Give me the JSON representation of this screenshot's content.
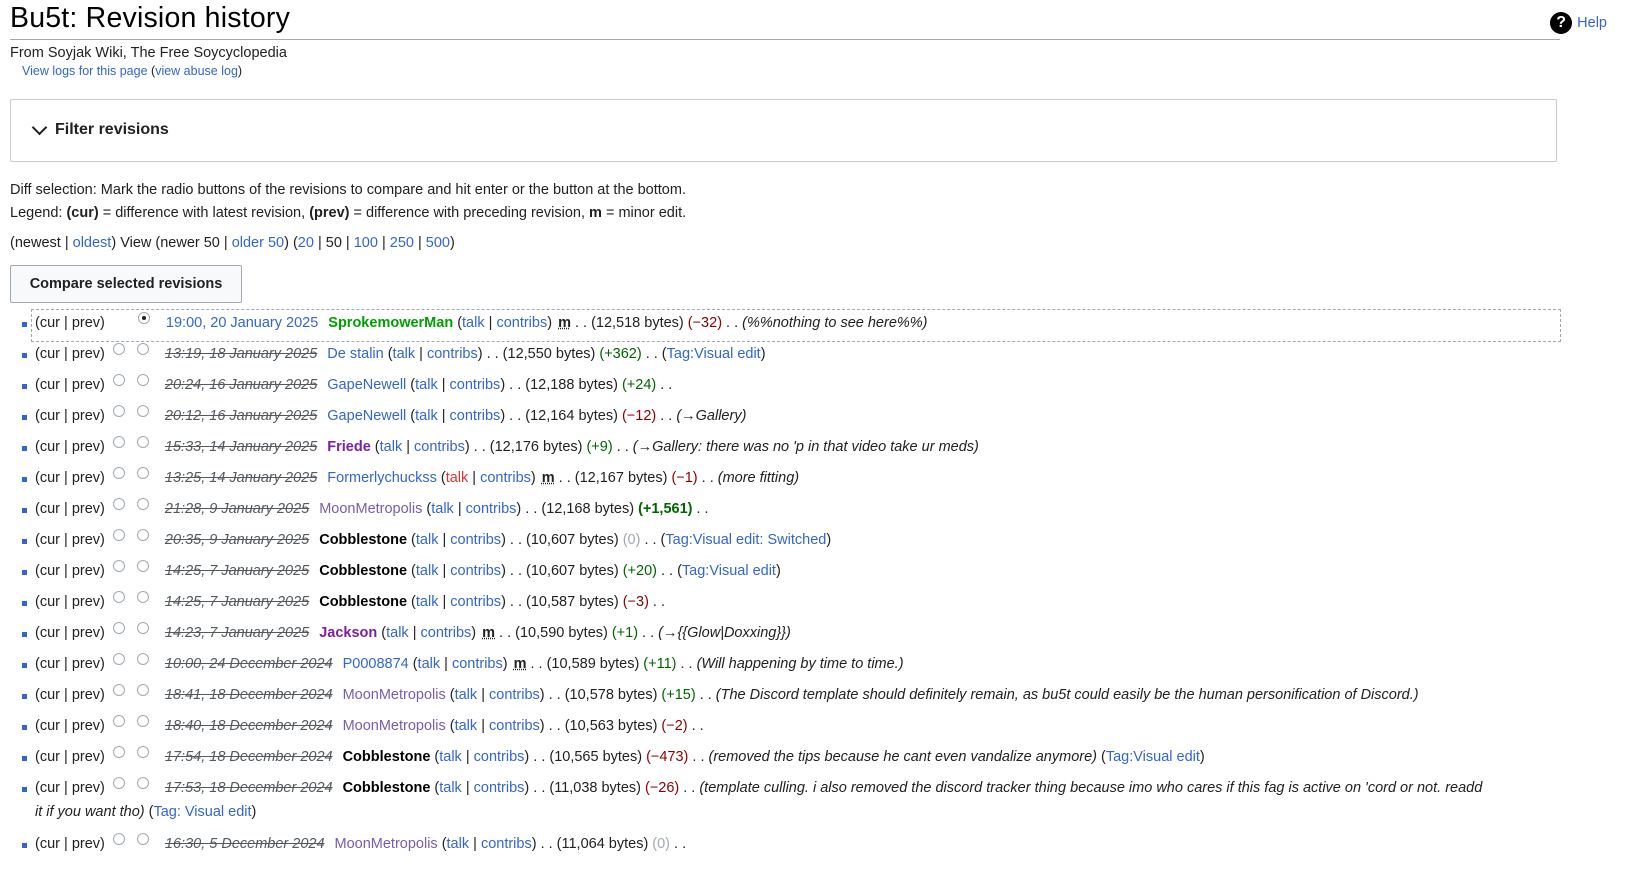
{
  "page": {
    "title": "Bu5t: Revision history",
    "help": "Help",
    "subtitle": "From Soyjak Wiki, The Free Soycyclopedia",
    "view_logs": "View logs for this page",
    "view_abuse_log": "view abuse log"
  },
  "filter": {
    "label": "Filter revisions"
  },
  "info": {
    "diff_selection": "Diff selection: Mark the radio buttons of the revisions to compare and hit enter or the button at the bottom.",
    "legend_prefix": "Legend: ",
    "legend_cur": "(cur)",
    "legend_cur_desc": " = difference with latest revision, ",
    "legend_prev": "(prev)",
    "legend_prev_desc": " = difference with preceding revision, ",
    "legend_m": "m",
    "legend_m_desc": " = minor edit."
  },
  "nav": {
    "newest": "newest",
    "oldest": "oldest",
    "view": "View",
    "newer": "newer 50",
    "older": "older 50",
    "limits": [
      "20",
      "50",
      "100",
      "250",
      "500"
    ]
  },
  "compare_button": "Compare selected revisions",
  "colors": {
    "link": "#3366cc",
    "visited": "#795cb2",
    "new": "#d73333",
    "plus": "#006400",
    "minus": "#8b0000"
  },
  "revisions": [
    {
      "date": "19:00, 20 January 2025",
      "user": "SprokemowerMan",
      "user_style": "green-bold",
      "talk": "talk",
      "contribs": "contribs",
      "minor": true,
      "bytes": "(12,518 bytes)",
      "diff": "(−32)",
      "diff_type": "neg",
      "comment": "(%%nothing to see here%%)",
      "tag": ""
    },
    {
      "date": "13:19, 18 January 2025",
      "user": "De stalin",
      "user_style": "link",
      "talk": "talk",
      "contribs": "contribs",
      "minor": false,
      "bytes": "(12,550 bytes)",
      "diff": "(+362)",
      "diff_type": "pos",
      "comment": "",
      "tag": "Visual edit"
    },
    {
      "date": "20:24, 16 January 2025",
      "user": "GapeNewell",
      "user_style": "link",
      "talk": "talk",
      "contribs": "contribs",
      "minor": false,
      "bytes": "(12,188 bytes)",
      "diff": "(+24)",
      "diff_type": "pos",
      "comment": "",
      "tag": ""
    },
    {
      "date": "20:12, 16 January 2025",
      "user": "GapeNewell",
      "user_style": "link",
      "talk": "talk",
      "contribs": "contribs",
      "minor": false,
      "bytes": "(12,164 bytes)",
      "diff": "(−12)",
      "diff_type": "neg",
      "comment": "(→Gallery)",
      "tag": ""
    },
    {
      "date": "15:33, 14 January 2025",
      "user": "Friede",
      "user_style": "purple-bold",
      "talk": "talk",
      "contribs": "contribs",
      "minor": false,
      "bytes": "(12,176 bytes)",
      "diff": "(+9)",
      "diff_type": "pos",
      "comment": "(→Gallery: there was no 'p in that video take ur meds)",
      "tag": ""
    },
    {
      "date": "13:25, 14 January 2025",
      "user": "Formerlychuckss",
      "user_style": "link",
      "talk": "talk",
      "contribs": "contribs",
      "talk_new": true,
      "minor": true,
      "bytes": "(12,167 bytes)",
      "diff": "(−1)",
      "diff_type": "neg",
      "comment": "(more fitting)",
      "tag": ""
    },
    {
      "date": "21:28, 9 January 2025",
      "user": "MoonMetropolis",
      "user_style": "visited",
      "talk": "talk",
      "contribs": "contribs",
      "minor": false,
      "bytes": "(12,168 bytes)",
      "diff": "(+1,561)",
      "diff_type": "pos-bold",
      "comment": "",
      "tag": ""
    },
    {
      "date": "20:35, 9 January 2025",
      "user": "Cobblestone",
      "user_style": "black-bold",
      "talk": "talk",
      "contribs": "contribs",
      "minor": false,
      "bytes": "(10,607 bytes)",
      "diff": "(0)",
      "diff_type": "zero",
      "comment": "",
      "tag": "Visual edit: Switched"
    },
    {
      "date": "14:25, 7 January 2025",
      "user": "Cobblestone",
      "user_style": "black-bold",
      "talk": "talk",
      "contribs": "contribs",
      "minor": false,
      "bytes": "(10,607 bytes)",
      "diff": "(+20)",
      "diff_type": "pos",
      "comment": "",
      "tag": "Visual edit"
    },
    {
      "date": "14:25, 7 January 2025",
      "user": "Cobblestone",
      "user_style": "black-bold",
      "talk": "talk",
      "contribs": "contribs",
      "minor": false,
      "bytes": "(10,587 bytes)",
      "diff": "(−3)",
      "diff_type": "neg",
      "comment": "",
      "tag": ""
    },
    {
      "date": "14:23, 7 January 2025",
      "user": "Jackson",
      "user_style": "purple-bold",
      "talk": "talk",
      "contribs": "contribs",
      "minor": true,
      "bytes": "(10,590 bytes)",
      "diff": "(+1)",
      "diff_type": "pos",
      "comment": "(→{{Glow|Doxxing}})",
      "tag": ""
    },
    {
      "date": "10:00, 24 December 2024",
      "user": "P0008874",
      "user_style": "link",
      "talk": "talk",
      "contribs": "contribs",
      "minor": true,
      "bytes": "(10,589 bytes)",
      "diff": "(+11)",
      "diff_type": "pos",
      "comment": "(Will happening by time to time.)",
      "tag": ""
    },
    {
      "date": "18:41, 18 December 2024",
      "user": "MoonMetropolis",
      "user_style": "visited",
      "talk": "talk",
      "contribs": "contribs",
      "minor": false,
      "bytes": "(10,578 bytes)",
      "diff": "(+15)",
      "diff_type": "pos",
      "comment": "(The Discord template should definitely remain, as bu5t could easily be the human personification of Discord.)",
      "tag": ""
    },
    {
      "date": "18:40, 18 December 2024",
      "user": "MoonMetropolis",
      "user_style": "visited",
      "talk": "talk",
      "contribs": "contribs",
      "minor": false,
      "bytes": "(10,563 bytes)",
      "diff": "(−2)",
      "diff_type": "neg",
      "comment": "",
      "tag": ""
    },
    {
      "date": "17:54, 18 December 2024",
      "user": "Cobblestone",
      "user_style": "black-bold",
      "talk": "talk",
      "contribs": "contribs",
      "minor": false,
      "bytes": "(10,565 bytes)",
      "diff": "(−473)",
      "diff_type": "neg",
      "comment": "(removed the tips because he cant even vandalize anymore)",
      "tag": "Visual edit"
    },
    {
      "date": "17:53, 18 December 2024",
      "user": "Cobblestone",
      "user_style": "black-bold",
      "talk": "talk",
      "contribs": "contribs",
      "minor": false,
      "bytes": "(11,038 bytes)",
      "diff": "(−26)",
      "diff_type": "neg",
      "comment": "(template culling. i also removed the discord tracker thing because imo who cares if this fag is active on 'cord or not. readd",
      "comment_cont": "it if you want tho)",
      "tag": "Visual edit"
    },
    {
      "date": "16:30, 5 December 2024",
      "user": "MoonMetropolis",
      "user_style": "visited",
      "talk": "talk",
      "contribs": "contribs",
      "minor": false,
      "bytes": "(11,064 bytes)",
      "diff": "(0)",
      "diff_type": "zero",
      "comment": "",
      "tag": ""
    }
  ],
  "labels": {
    "cur": "cur",
    "prev": "prev",
    "tag_prefix": "Tag: ",
    "minor_mark": "m"
  }
}
